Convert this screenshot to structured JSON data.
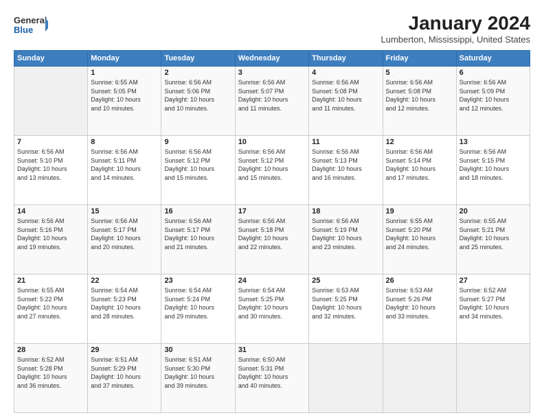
{
  "logo": {
    "line1": "General",
    "line2": "Blue",
    "icon": "▶"
  },
  "title": "January 2024",
  "subtitle": "Lumberton, Mississippi, United States",
  "weekdays": [
    "Sunday",
    "Monday",
    "Tuesday",
    "Wednesday",
    "Thursday",
    "Friday",
    "Saturday"
  ],
  "weeks": [
    [
      {
        "day": "",
        "info": ""
      },
      {
        "day": "1",
        "info": "Sunrise: 6:55 AM\nSunset: 5:05 PM\nDaylight: 10 hours\nand 10 minutes."
      },
      {
        "day": "2",
        "info": "Sunrise: 6:56 AM\nSunset: 5:06 PM\nDaylight: 10 hours\nand 10 minutes."
      },
      {
        "day": "3",
        "info": "Sunrise: 6:56 AM\nSunset: 5:07 PM\nDaylight: 10 hours\nand 11 minutes."
      },
      {
        "day": "4",
        "info": "Sunrise: 6:56 AM\nSunset: 5:08 PM\nDaylight: 10 hours\nand 11 minutes."
      },
      {
        "day": "5",
        "info": "Sunrise: 6:56 AM\nSunset: 5:08 PM\nDaylight: 10 hours\nand 12 minutes."
      },
      {
        "day": "6",
        "info": "Sunrise: 6:56 AM\nSunset: 5:09 PM\nDaylight: 10 hours\nand 12 minutes."
      }
    ],
    [
      {
        "day": "7",
        "info": "Sunrise: 6:56 AM\nSunset: 5:10 PM\nDaylight: 10 hours\nand 13 minutes."
      },
      {
        "day": "8",
        "info": "Sunrise: 6:56 AM\nSunset: 5:11 PM\nDaylight: 10 hours\nand 14 minutes."
      },
      {
        "day": "9",
        "info": "Sunrise: 6:56 AM\nSunset: 5:12 PM\nDaylight: 10 hours\nand 15 minutes."
      },
      {
        "day": "10",
        "info": "Sunrise: 6:56 AM\nSunset: 5:12 PM\nDaylight: 10 hours\nand 15 minutes."
      },
      {
        "day": "11",
        "info": "Sunrise: 6:56 AM\nSunset: 5:13 PM\nDaylight: 10 hours\nand 16 minutes."
      },
      {
        "day": "12",
        "info": "Sunrise: 6:56 AM\nSunset: 5:14 PM\nDaylight: 10 hours\nand 17 minutes."
      },
      {
        "day": "13",
        "info": "Sunrise: 6:56 AM\nSunset: 5:15 PM\nDaylight: 10 hours\nand 18 minutes."
      }
    ],
    [
      {
        "day": "14",
        "info": "Sunrise: 6:56 AM\nSunset: 5:16 PM\nDaylight: 10 hours\nand 19 minutes."
      },
      {
        "day": "15",
        "info": "Sunrise: 6:56 AM\nSunset: 5:17 PM\nDaylight: 10 hours\nand 20 minutes."
      },
      {
        "day": "16",
        "info": "Sunrise: 6:56 AM\nSunset: 5:17 PM\nDaylight: 10 hours\nand 21 minutes."
      },
      {
        "day": "17",
        "info": "Sunrise: 6:56 AM\nSunset: 5:18 PM\nDaylight: 10 hours\nand 22 minutes."
      },
      {
        "day": "18",
        "info": "Sunrise: 6:56 AM\nSunset: 5:19 PM\nDaylight: 10 hours\nand 23 minutes."
      },
      {
        "day": "19",
        "info": "Sunrise: 6:55 AM\nSunset: 5:20 PM\nDaylight: 10 hours\nand 24 minutes."
      },
      {
        "day": "20",
        "info": "Sunrise: 6:55 AM\nSunset: 5:21 PM\nDaylight: 10 hours\nand 25 minutes."
      }
    ],
    [
      {
        "day": "21",
        "info": "Sunrise: 6:55 AM\nSunset: 5:22 PM\nDaylight: 10 hours\nand 27 minutes."
      },
      {
        "day": "22",
        "info": "Sunrise: 6:54 AM\nSunset: 5:23 PM\nDaylight: 10 hours\nand 28 minutes."
      },
      {
        "day": "23",
        "info": "Sunrise: 6:54 AM\nSunset: 5:24 PM\nDaylight: 10 hours\nand 29 minutes."
      },
      {
        "day": "24",
        "info": "Sunrise: 6:54 AM\nSunset: 5:25 PM\nDaylight: 10 hours\nand 30 minutes."
      },
      {
        "day": "25",
        "info": "Sunrise: 6:53 AM\nSunset: 5:25 PM\nDaylight: 10 hours\nand 32 minutes."
      },
      {
        "day": "26",
        "info": "Sunrise: 6:53 AM\nSunset: 5:26 PM\nDaylight: 10 hours\nand 33 minutes."
      },
      {
        "day": "27",
        "info": "Sunrise: 6:52 AM\nSunset: 5:27 PM\nDaylight: 10 hours\nand 34 minutes."
      }
    ],
    [
      {
        "day": "28",
        "info": "Sunrise: 6:52 AM\nSunset: 5:28 PM\nDaylight: 10 hours\nand 36 minutes."
      },
      {
        "day": "29",
        "info": "Sunrise: 6:51 AM\nSunset: 5:29 PM\nDaylight: 10 hours\nand 37 minutes."
      },
      {
        "day": "30",
        "info": "Sunrise: 6:51 AM\nSunset: 5:30 PM\nDaylight: 10 hours\nand 39 minutes."
      },
      {
        "day": "31",
        "info": "Sunrise: 6:50 AM\nSunset: 5:31 PM\nDaylight: 10 hours\nand 40 minutes."
      },
      {
        "day": "",
        "info": ""
      },
      {
        "day": "",
        "info": ""
      },
      {
        "day": "",
        "info": ""
      }
    ]
  ]
}
